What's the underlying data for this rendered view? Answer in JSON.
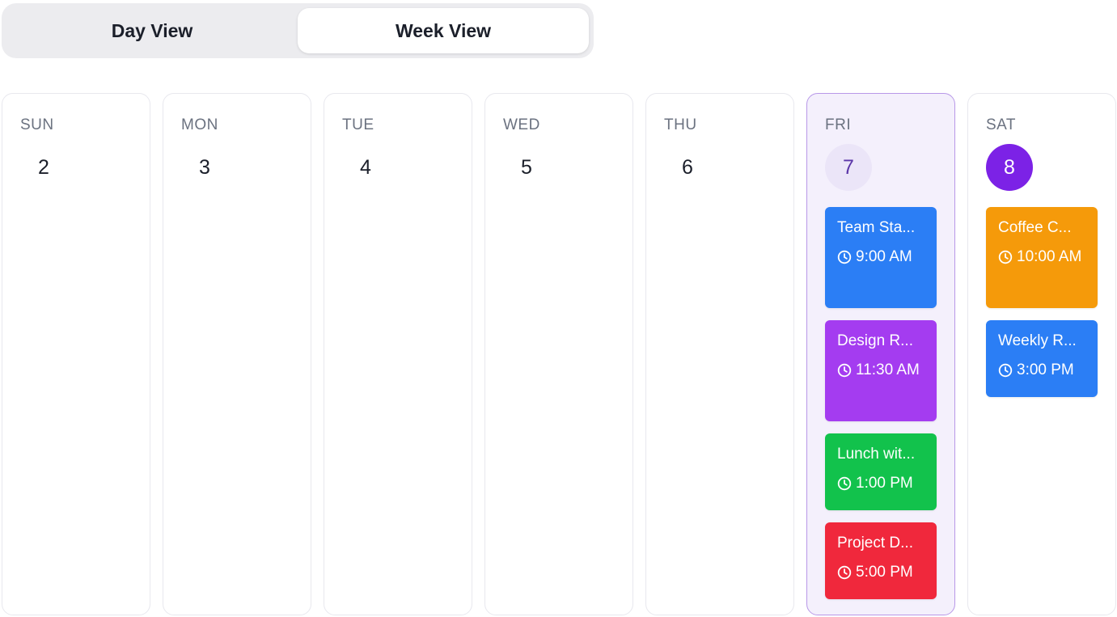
{
  "view_toggle": {
    "day_label": "Day View",
    "week_label": "Week View",
    "active": "week"
  },
  "days": [
    {
      "name": "SUN",
      "number": "2"
    },
    {
      "name": "MON",
      "number": "3"
    },
    {
      "name": "TUE",
      "number": "4"
    },
    {
      "name": "WED",
      "number": "5"
    },
    {
      "name": "THU",
      "number": "6"
    },
    {
      "name": "FRI",
      "number": "7",
      "is_today": true,
      "events": [
        {
          "title": "Team Sta...",
          "time": "9:00 AM",
          "color": "#2b7ef5"
        },
        {
          "title": "Design R...",
          "time": "11:30 AM",
          "color": "#a43cf0"
        },
        {
          "title": "Lunch wit...",
          "time": "1:00 PM",
          "color": "#12c24c"
        },
        {
          "title": "Project D...",
          "time": "5:00 PM",
          "color": "#f0283c"
        }
      ]
    },
    {
      "name": "SAT",
      "number": "8",
      "is_selected": true,
      "events": [
        {
          "title": "Coffee C...",
          "time": "10:00 AM",
          "color": "#f59a0a"
        },
        {
          "title": "Weekly R...",
          "time": "3:00 PM",
          "color": "#2b7ef5"
        }
      ]
    }
  ],
  "colors": {
    "today_background": "#f4f0fc",
    "today_border": "#b898e8",
    "selected_date": "#7c22e6"
  }
}
